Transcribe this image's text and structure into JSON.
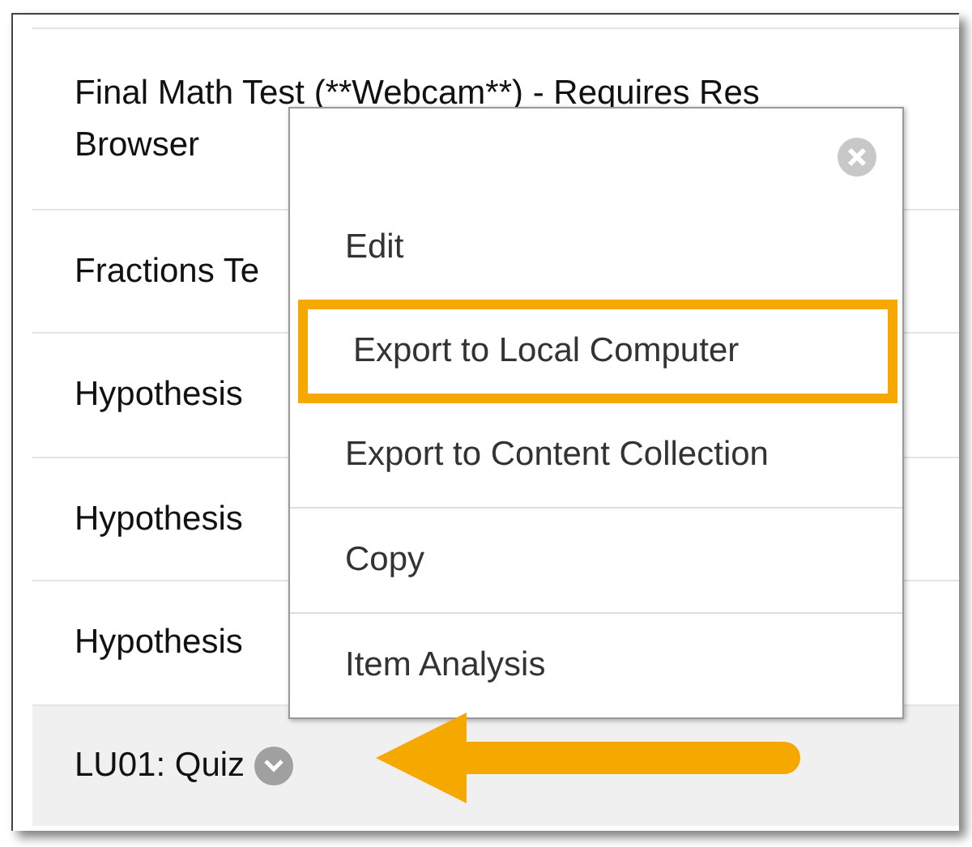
{
  "rows": [
    {
      "lines": [
        "Final Math Test (**Webcam**) - Requires Res",
        "Browser"
      ],
      "hovered": false
    },
    {
      "lines": [
        "Fractions Te"
      ],
      "hovered": false
    },
    {
      "lines": [
        "Hypothesis"
      ],
      "hovered": false
    },
    {
      "lines": [
        "Hypothesis"
      ],
      "hovered": false
    },
    {
      "lines": [
        "Hypothesis"
      ],
      "hovered": false
    },
    {
      "lines": [
        "LU01: Quiz"
      ],
      "hovered": true
    }
  ],
  "menu": {
    "items": [
      {
        "label": "Edit",
        "highlighted": false,
        "divider_after": false
      },
      {
        "label": "Export to Local Computer",
        "highlighted": true,
        "divider_after": false
      },
      {
        "label": "Export to Content Collection",
        "highlighted": false,
        "divider_after": true
      },
      {
        "label": "Copy",
        "highlighted": false,
        "divider_after": true
      },
      {
        "label": "Item Analysis",
        "highlighted": false,
        "divider_after": false
      }
    ]
  }
}
